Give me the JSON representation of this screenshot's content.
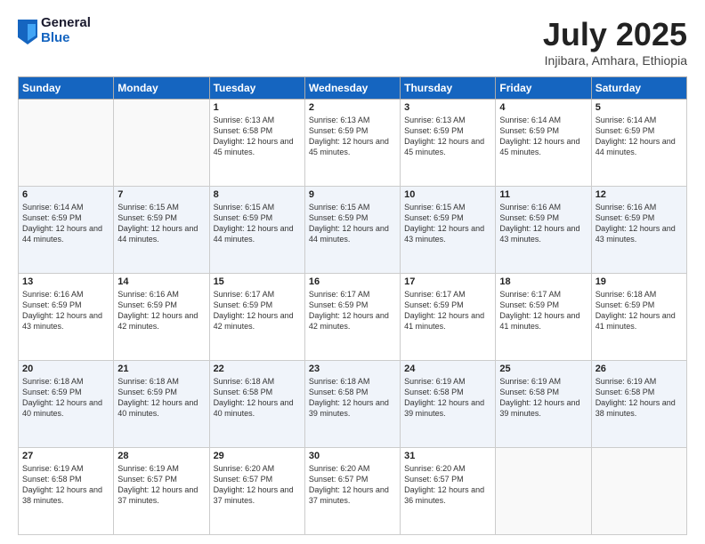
{
  "header": {
    "logo_general": "General",
    "logo_blue": "Blue",
    "title": "July 2025",
    "location": "Injibara, Amhara, Ethiopia"
  },
  "weekdays": [
    "Sunday",
    "Monday",
    "Tuesday",
    "Wednesday",
    "Thursday",
    "Friday",
    "Saturday"
  ],
  "weeks": [
    [
      {
        "day": "",
        "empty": true
      },
      {
        "day": "",
        "empty": true
      },
      {
        "day": "1",
        "sunrise": "6:13 AM",
        "sunset": "6:58 PM",
        "daylight": "12 hours and 45 minutes."
      },
      {
        "day": "2",
        "sunrise": "6:13 AM",
        "sunset": "6:59 PM",
        "daylight": "12 hours and 45 minutes."
      },
      {
        "day": "3",
        "sunrise": "6:13 AM",
        "sunset": "6:59 PM",
        "daylight": "12 hours and 45 minutes."
      },
      {
        "day": "4",
        "sunrise": "6:14 AM",
        "sunset": "6:59 PM",
        "daylight": "12 hours and 45 minutes."
      },
      {
        "day": "5",
        "sunrise": "6:14 AM",
        "sunset": "6:59 PM",
        "daylight": "12 hours and 44 minutes."
      }
    ],
    [
      {
        "day": "6",
        "sunrise": "6:14 AM",
        "sunset": "6:59 PM",
        "daylight": "12 hours and 44 minutes."
      },
      {
        "day": "7",
        "sunrise": "6:15 AM",
        "sunset": "6:59 PM",
        "daylight": "12 hours and 44 minutes."
      },
      {
        "day": "8",
        "sunrise": "6:15 AM",
        "sunset": "6:59 PM",
        "daylight": "12 hours and 44 minutes."
      },
      {
        "day": "9",
        "sunrise": "6:15 AM",
        "sunset": "6:59 PM",
        "daylight": "12 hours and 44 minutes."
      },
      {
        "day": "10",
        "sunrise": "6:15 AM",
        "sunset": "6:59 PM",
        "daylight": "12 hours and 43 minutes."
      },
      {
        "day": "11",
        "sunrise": "6:16 AM",
        "sunset": "6:59 PM",
        "daylight": "12 hours and 43 minutes."
      },
      {
        "day": "12",
        "sunrise": "6:16 AM",
        "sunset": "6:59 PM",
        "daylight": "12 hours and 43 minutes."
      }
    ],
    [
      {
        "day": "13",
        "sunrise": "6:16 AM",
        "sunset": "6:59 PM",
        "daylight": "12 hours and 43 minutes."
      },
      {
        "day": "14",
        "sunrise": "6:16 AM",
        "sunset": "6:59 PM",
        "daylight": "12 hours and 42 minutes."
      },
      {
        "day": "15",
        "sunrise": "6:17 AM",
        "sunset": "6:59 PM",
        "daylight": "12 hours and 42 minutes."
      },
      {
        "day": "16",
        "sunrise": "6:17 AM",
        "sunset": "6:59 PM",
        "daylight": "12 hours and 42 minutes."
      },
      {
        "day": "17",
        "sunrise": "6:17 AM",
        "sunset": "6:59 PM",
        "daylight": "12 hours and 41 minutes."
      },
      {
        "day": "18",
        "sunrise": "6:17 AM",
        "sunset": "6:59 PM",
        "daylight": "12 hours and 41 minutes."
      },
      {
        "day": "19",
        "sunrise": "6:18 AM",
        "sunset": "6:59 PM",
        "daylight": "12 hours and 41 minutes."
      }
    ],
    [
      {
        "day": "20",
        "sunrise": "6:18 AM",
        "sunset": "6:59 PM",
        "daylight": "12 hours and 40 minutes."
      },
      {
        "day": "21",
        "sunrise": "6:18 AM",
        "sunset": "6:59 PM",
        "daylight": "12 hours and 40 minutes."
      },
      {
        "day": "22",
        "sunrise": "6:18 AM",
        "sunset": "6:58 PM",
        "daylight": "12 hours and 40 minutes."
      },
      {
        "day": "23",
        "sunrise": "6:18 AM",
        "sunset": "6:58 PM",
        "daylight": "12 hours and 39 minutes."
      },
      {
        "day": "24",
        "sunrise": "6:19 AM",
        "sunset": "6:58 PM",
        "daylight": "12 hours and 39 minutes."
      },
      {
        "day": "25",
        "sunrise": "6:19 AM",
        "sunset": "6:58 PM",
        "daylight": "12 hours and 39 minutes."
      },
      {
        "day": "26",
        "sunrise": "6:19 AM",
        "sunset": "6:58 PM",
        "daylight": "12 hours and 38 minutes."
      }
    ],
    [
      {
        "day": "27",
        "sunrise": "6:19 AM",
        "sunset": "6:58 PM",
        "daylight": "12 hours and 38 minutes."
      },
      {
        "day": "28",
        "sunrise": "6:19 AM",
        "sunset": "6:57 PM",
        "daylight": "12 hours and 37 minutes."
      },
      {
        "day": "29",
        "sunrise": "6:20 AM",
        "sunset": "6:57 PM",
        "daylight": "12 hours and 37 minutes."
      },
      {
        "day": "30",
        "sunrise": "6:20 AM",
        "sunset": "6:57 PM",
        "daylight": "12 hours and 37 minutes."
      },
      {
        "day": "31",
        "sunrise": "6:20 AM",
        "sunset": "6:57 PM",
        "daylight": "12 hours and 36 minutes."
      },
      {
        "day": "",
        "empty": true
      },
      {
        "day": "",
        "empty": true
      }
    ]
  ],
  "labels": {
    "sunrise_prefix": "Sunrise: ",
    "sunset_prefix": "Sunset: ",
    "daylight_prefix": "Daylight: "
  }
}
